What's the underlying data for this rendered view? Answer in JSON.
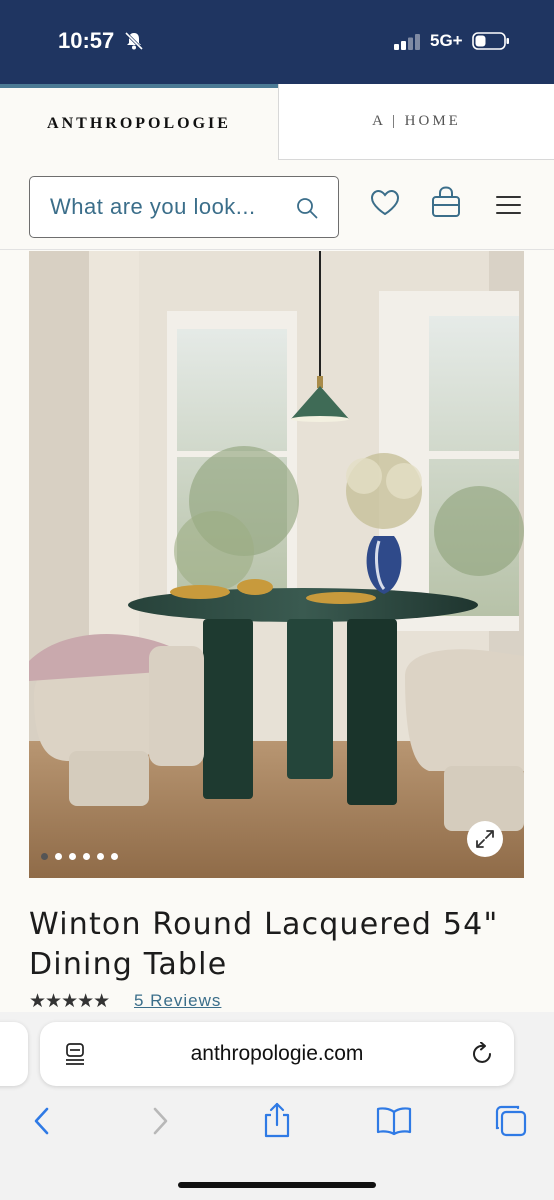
{
  "status": {
    "time": "10:57",
    "network": "5G+"
  },
  "brand_tabs": {
    "anthropologie": "ANTHROPOLOGIE",
    "home": "A | HOME"
  },
  "search": {
    "placeholder": "What are you look..."
  },
  "gallery": {
    "slide_count": 6,
    "active_index": 0
  },
  "product": {
    "title": "Winton Round Lacquered 54\" Dining Table",
    "stars": "★★★★★",
    "rating": 4.5,
    "reviews": "5 Reviews"
  },
  "browser": {
    "url": "anthropologie.com"
  },
  "colors": {
    "status_bar": "#1f3561",
    "accent": "#3b6e8a",
    "tab_indicator": "#4b7a94",
    "ios_blue": "#2f7ae5"
  }
}
